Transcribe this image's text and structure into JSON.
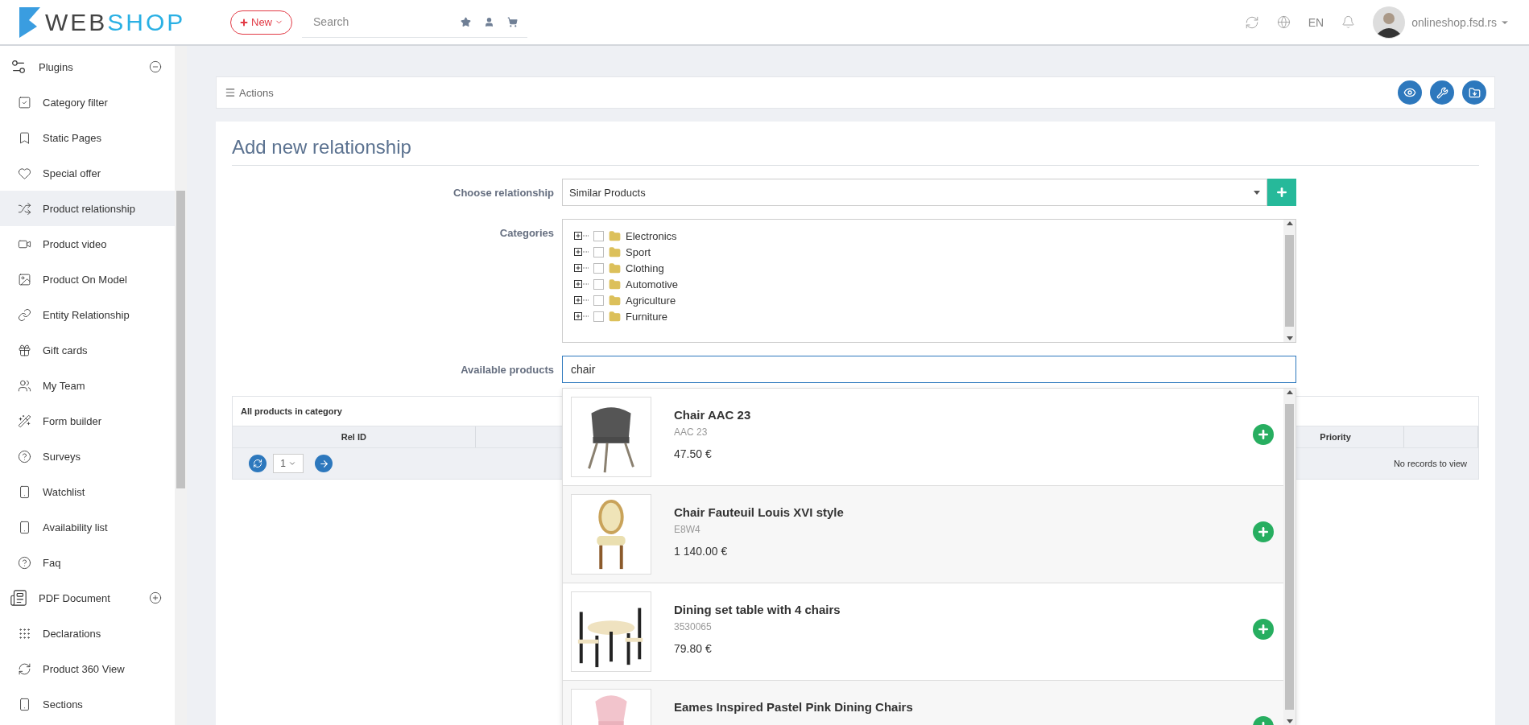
{
  "header": {
    "logo": {
      "part1": "WEB",
      "part2": "SHOP"
    },
    "new_button": "New",
    "search": {
      "placeholder": "Search"
    },
    "language": "EN",
    "user": "onlineshop.fsd.rs"
  },
  "sidebar": {
    "items": [
      {
        "label": "Plugins",
        "kind": "group",
        "expanded": true,
        "selected": false
      },
      {
        "label": "Category filter",
        "kind": "item",
        "selected": false
      },
      {
        "label": "Static Pages",
        "kind": "item",
        "selected": false
      },
      {
        "label": "Special offer",
        "kind": "item",
        "selected": false
      },
      {
        "label": "Product relationship",
        "kind": "item",
        "selected": true
      },
      {
        "label": "Product video",
        "kind": "item",
        "selected": false
      },
      {
        "label": "Product On Model",
        "kind": "item",
        "selected": false
      },
      {
        "label": "Entity Relationship",
        "kind": "item",
        "selected": false
      },
      {
        "label": "Gift cards",
        "kind": "item",
        "selected": false
      },
      {
        "label": "My Team",
        "kind": "item",
        "selected": false
      },
      {
        "label": "Form builder",
        "kind": "item",
        "selected": false
      },
      {
        "label": "Surveys",
        "kind": "item",
        "selected": false
      },
      {
        "label": "Watchlist",
        "kind": "item",
        "selected": false
      },
      {
        "label": "Availability list",
        "kind": "item",
        "selected": false
      },
      {
        "label": "Faq",
        "kind": "item",
        "selected": false
      },
      {
        "label": "PDF Document",
        "kind": "group",
        "expanded": false,
        "selected": false
      },
      {
        "label": "Declarations",
        "kind": "item",
        "selected": false
      },
      {
        "label": "Product 360 View",
        "kind": "item",
        "selected": false
      },
      {
        "label": "Sections",
        "kind": "item",
        "selected": false
      }
    ]
  },
  "actions": {
    "label": "Actions"
  },
  "form": {
    "title": "Add new relationship",
    "relationship": {
      "label": "Choose relationship",
      "value": "Similar Products"
    },
    "categories": {
      "label": "Categories",
      "items": [
        {
          "label": "Electronics",
          "expanded": false,
          "checked": false
        },
        {
          "label": "Sport",
          "expanded": false,
          "checked": false
        },
        {
          "label": "Clothing",
          "expanded": false,
          "checked": false
        },
        {
          "label": "Automotive",
          "expanded": false,
          "checked": false
        },
        {
          "label": "Agriculture",
          "expanded": false,
          "checked": false
        },
        {
          "label": "Furniture",
          "expanded": false,
          "checked": false
        }
      ]
    },
    "available": {
      "label": "Available products",
      "value": "chair"
    }
  },
  "table": {
    "title": "All products in category",
    "columns": [
      "Rel ID",
      "Priority"
    ],
    "page": "1",
    "empty": "No records to view"
  },
  "results": [
    {
      "name": "Chair AAC 23",
      "code": "AAC 23",
      "price": "47.50 €",
      "kind": "picture"
    },
    {
      "name": "Chair Fauteuil Louis XVI style",
      "code": "E8W4",
      "price": "1 140.00 €",
      "kind": "picture"
    },
    {
      "name": "Dining set table with 4 chairs",
      "code": "3530065",
      "price": "79.80 €",
      "kind": "picture"
    },
    {
      "name": "Eames Inspired Pastel Pink Dining Chairs",
      "kind": "picture"
    }
  ]
}
